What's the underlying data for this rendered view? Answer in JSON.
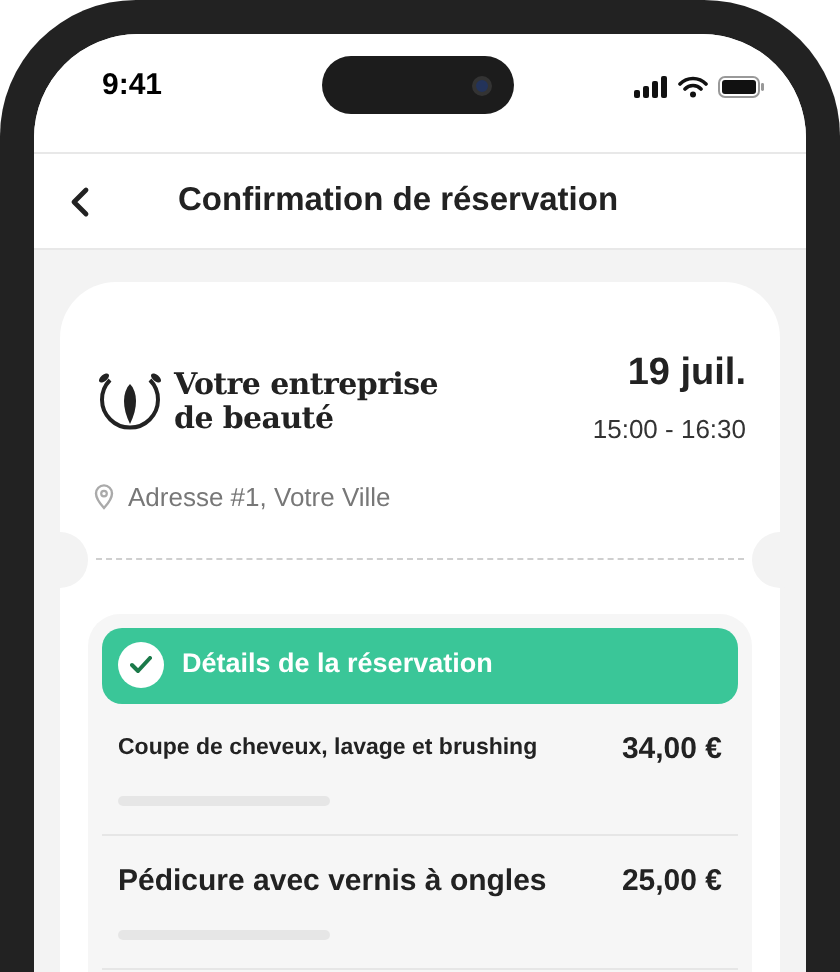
{
  "status_bar": {
    "time": "9:41"
  },
  "header": {
    "title": "Confirmation de réservation"
  },
  "business": {
    "name_line_1": "Votre entreprise",
    "name_line_2": "de beauté",
    "date": "19 juil.",
    "time_range": "15:00 - 16:30",
    "address": "Adresse #1, Votre Ville"
  },
  "details": {
    "title": "Détails de la réservation",
    "confirmed": true,
    "items": [
      {
        "name": "Coupe de cheveux, lavage et brushing",
        "price": "34,00 €"
      },
      {
        "name": "Pédicure avec vernis à ongles",
        "price": "25,00 €"
      }
    ]
  }
}
